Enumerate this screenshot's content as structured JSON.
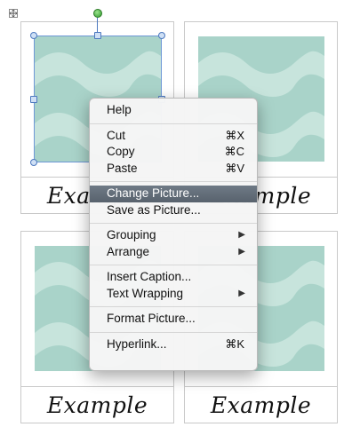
{
  "captions": [
    "Example",
    "Example",
    "Example",
    "Example"
  ],
  "context_menu": {
    "highlighted_index": 6,
    "items": [
      {
        "label": "Help",
        "shortcut": "",
        "submenu": false
      },
      {
        "label": "Cut",
        "shortcut": "⌘X",
        "submenu": false
      },
      {
        "label": "Copy",
        "shortcut": "⌘C",
        "submenu": false
      },
      {
        "label": "Paste",
        "shortcut": "⌘V",
        "submenu": false
      },
      {
        "label": "Change Picture...",
        "shortcut": "",
        "submenu": false
      },
      {
        "label": "Save as Picture...",
        "shortcut": "",
        "submenu": false
      },
      {
        "label": "Grouping",
        "shortcut": "",
        "submenu": true
      },
      {
        "label": "Arrange",
        "shortcut": "",
        "submenu": true
      },
      {
        "label": "Insert Caption...",
        "shortcut": "",
        "submenu": false
      },
      {
        "label": "Text Wrapping",
        "shortcut": "",
        "submenu": true
      },
      {
        "label": "Format Picture...",
        "shortcut": "",
        "submenu": false
      },
      {
        "label": "Hyperlink...",
        "shortcut": "⌘K",
        "submenu": false
      }
    ]
  },
  "colors": {
    "picture_bg": "#a9d3c9",
    "wave": "#c7e4dc",
    "menu_highlight": "#626c77",
    "selection": "#4d79bf"
  }
}
